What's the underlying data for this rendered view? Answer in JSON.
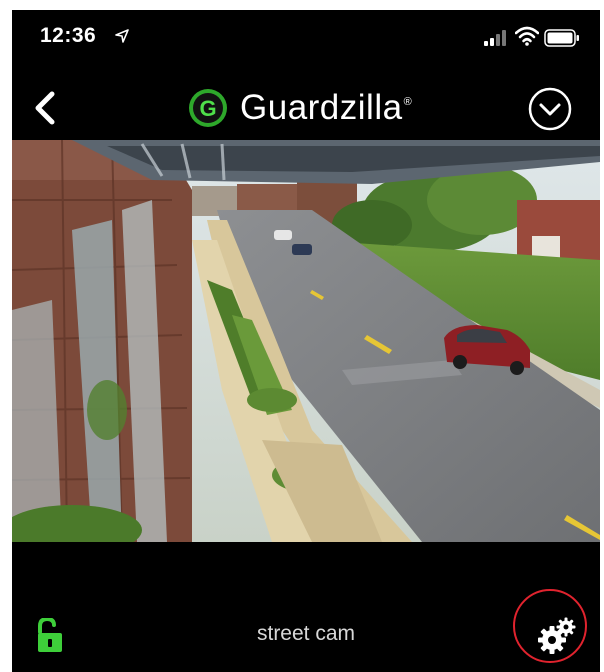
{
  "status_bar": {
    "time": "12:36",
    "location_icon": "location-arrow-icon",
    "signal_icon": "signal-bars-icon",
    "wifi_icon": "wifi-icon",
    "battery_icon": "battery-icon"
  },
  "nav": {
    "back_icon": "chevron-left-icon",
    "brand_name": "Guardzilla",
    "brand_reg": "®",
    "brand_logo_letter": "G",
    "menu_icon": "chevron-down-circle-icon"
  },
  "camera": {
    "name": "street cam",
    "view": "live-camera-feed"
  },
  "controls": {
    "lock_icon": "unlocked-padlock-icon",
    "settings_icon": "gears-icon"
  },
  "colors": {
    "background": "#000000",
    "accent_green": "#3ecf3a",
    "text_light": "#d8d8d8",
    "highlight_red": "#e0232e"
  }
}
